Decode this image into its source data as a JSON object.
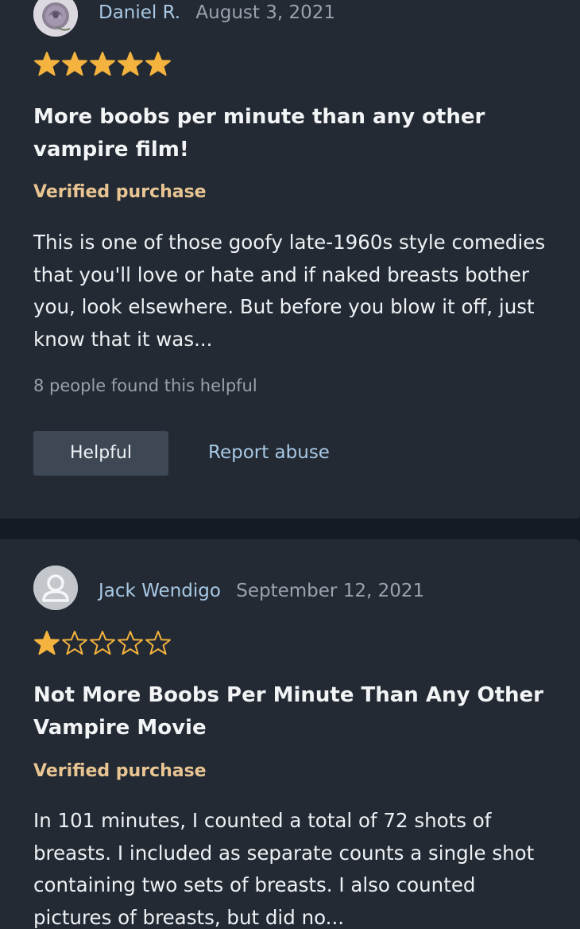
{
  "reviews": [
    {
      "author": "Daniel R.",
      "date": "August 3, 2021",
      "rating": 5,
      "title": "More boobs per minute than any other vampire film!",
      "verified": "Verified purchase",
      "body": "This is one of those goofy late-1960s style comedies that you'll love or hate and if naked breasts bother you, look elsewhere. But before you blow it off, just know that it was...",
      "helpful_count_text": "8 people found this helpful",
      "helpful_label": "Helpful",
      "report_label": "Report abuse"
    },
    {
      "author": "Jack Wendigo",
      "date": "September 12, 2021",
      "rating": 1,
      "title": "Not More Boobs Per Minute Than Any Other Vampire Movie",
      "verified": "Verified purchase",
      "body": "In 101 minutes, I counted a total of 72 shots of breasts. I included as separate counts a single shot containing two sets of breasts. I also counted pictures of breasts, but did no..."
    }
  ],
  "colors": {
    "star": "#f3b33e",
    "link": "#a9c9e6",
    "verified": "#e9c593"
  },
  "icons": {
    "avatar_1": "rose-avatar-icon",
    "avatar_2": "default-user-icon"
  }
}
